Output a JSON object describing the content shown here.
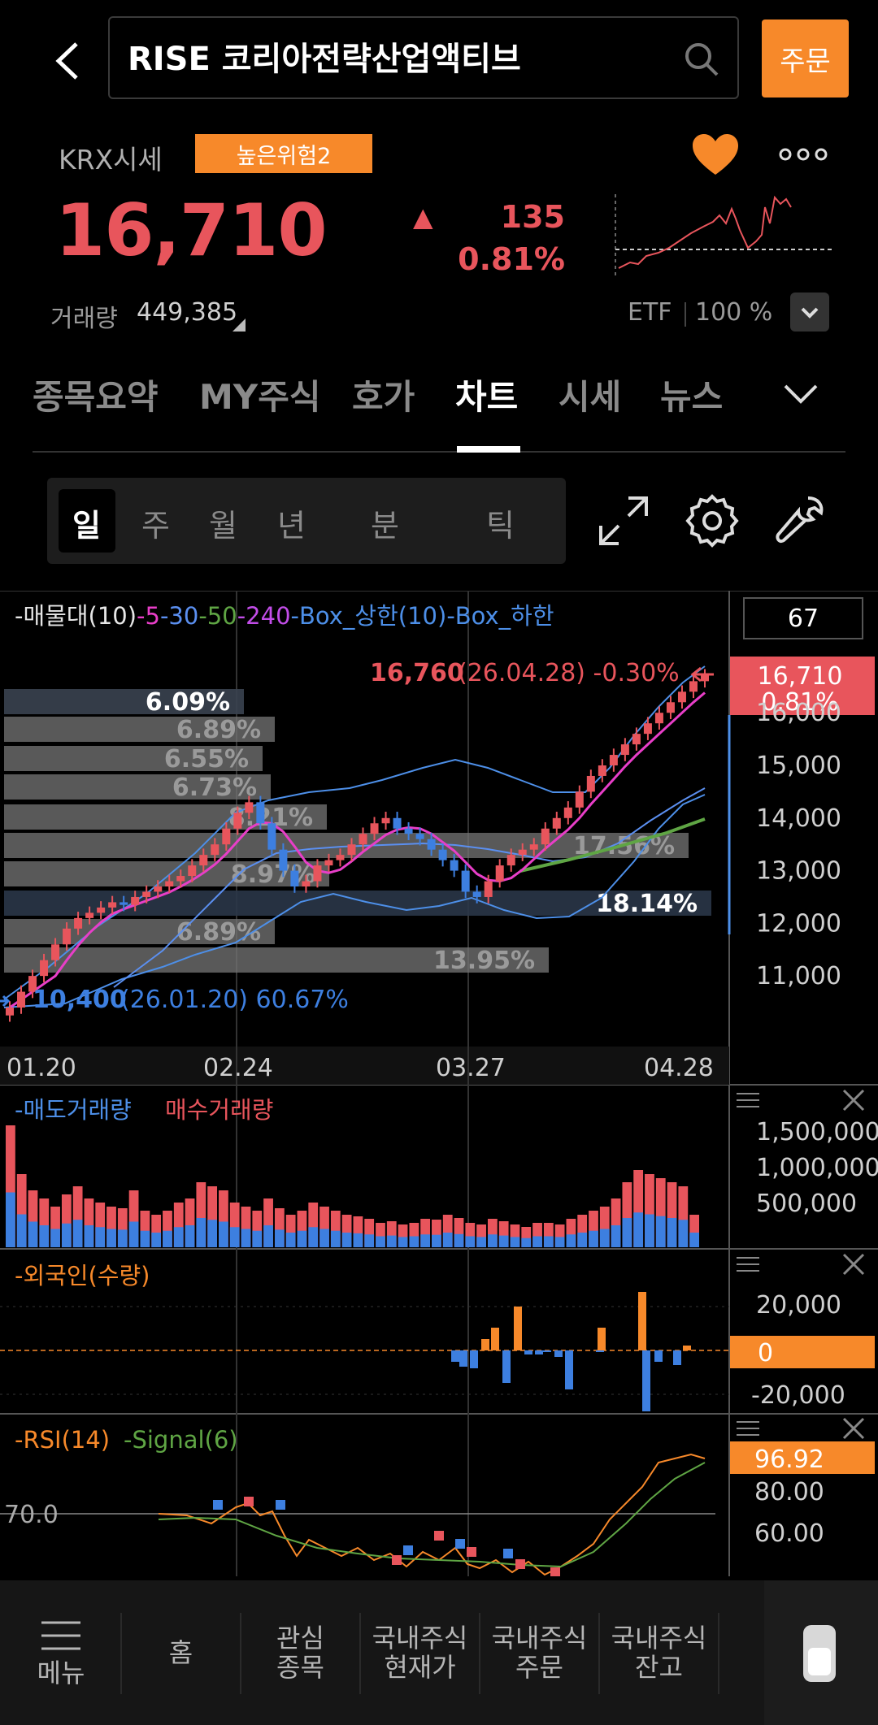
{
  "header": {
    "title": "RISE 코리아전략산업액티브",
    "order_label": "주문",
    "back_icon": "chevron-left-icon",
    "search_icon": "search-icon"
  },
  "quote": {
    "market_label": "KRX시세",
    "risk_badge": "높은위험2",
    "price": "16,710",
    "change_arrow": "▲",
    "change": "135",
    "change_pct": "0.81%",
    "volume_label": "거래량",
    "volume": "449,385",
    "etf_label": "ETF",
    "etf_pct": "100 %",
    "colors": {
      "up": "#e8555c",
      "accent": "#f7892a",
      "down": "#3d7fe0"
    }
  },
  "tabs": [
    "종목요약",
    "MY주식",
    "호가",
    "차트",
    "시세",
    "뉴스"
  ],
  "active_tab": "차트",
  "periods": [
    "일",
    "주",
    "월",
    "년",
    "분",
    "틱"
  ],
  "active_period": "일",
  "chart": {
    "count_box": "67",
    "legend": [
      {
        "text": "-매물대(10)",
        "color": "#e6e6e6"
      },
      {
        "text": "-5",
        "color": "#e83ec8"
      },
      {
        "text": "-30",
        "color": "#5b8ff0"
      },
      {
        "text": "-50",
        "color": "#5fa544"
      },
      {
        "text": "-240",
        "color": "#c24de8"
      },
      {
        "text": "-Box_상한(10)",
        "color": "#4d8fe8"
      },
      {
        "text": "-Box_하한",
        "color": "#4d8fe8"
      }
    ],
    "high_price": "16,760",
    "high_info": "(26.04.28)  -0.30%",
    "low_price": "10,400",
    "low_info": "(26.01.20)  60.67%",
    "current_tag_price": "16,710",
    "current_tag_pct": "0.81%",
    "y_ticks": [
      "16,000",
      "15,000",
      "14,000",
      "13,000",
      "12,000",
      "11,000"
    ],
    "x_ticks": [
      "01.20",
      "02.24",
      "03.27",
      "04.28"
    ],
    "volume_profile": [
      "6.09%",
      "6.89%",
      "6.55%",
      "6.73%",
      "8.21%",
      "17.56%",
      "8.97%",
      "18.14%",
      "6.89%",
      "13.95%"
    ]
  },
  "chart_data": {
    "type": "candlestick",
    "x": [
      "01.20",
      "02.24",
      "03.27",
      "04.28"
    ],
    "ylim": [
      10400,
      16760
    ],
    "current": 16710,
    "high": 16760,
    "low": 10400,
    "closes_approx": [
      10400,
      10700,
      11000,
      11300,
      11600,
      11900,
      12100,
      12200,
      12300,
      12400,
      12350,
      12500,
      12600,
      12700,
      12800,
      12900,
      13100,
      13300,
      13500,
      13800,
      14100,
      14300,
      13900,
      13400,
      13000,
      12700,
      12800,
      13100,
      13200,
      13300,
      13500,
      13700,
      13900,
      14000,
      13800,
      13700,
      13600,
      13400,
      13200,
      13000,
      12600,
      12500,
      12800,
      13100,
      13300,
      13400,
      13500,
      13800,
      14000,
      14200,
      14500,
      14800,
      15000,
      15200,
      15400,
      15600,
      15800,
      16000,
      16200,
      16400,
      16600,
      16710
    ]
  },
  "volume_panel": {
    "legend_sell": "-매도거래량",
    "legend_buy": "매수거래량",
    "y_ticks": [
      "1,500,000",
      "1,000,000",
      "500,000"
    ]
  },
  "foreign_panel": {
    "legend": "-외국인(수량)",
    "y_ticks": [
      "20,000",
      "-20,000"
    ],
    "zero_tag": "0"
  },
  "rsi_panel": {
    "legend_rsi": "-RSI(14)",
    "legend_signal": "-Signal(6)",
    "level_label": "70.0",
    "y_ticks": [
      "80.00",
      "60.00"
    ],
    "value_tag": "96.92"
  },
  "navbar": {
    "menu": "메뉴",
    "items": [
      "홈",
      "관심\n종목",
      "국내주식\n현재가",
      "국내주식\n주문",
      "국내주식\n잔고"
    ]
  }
}
